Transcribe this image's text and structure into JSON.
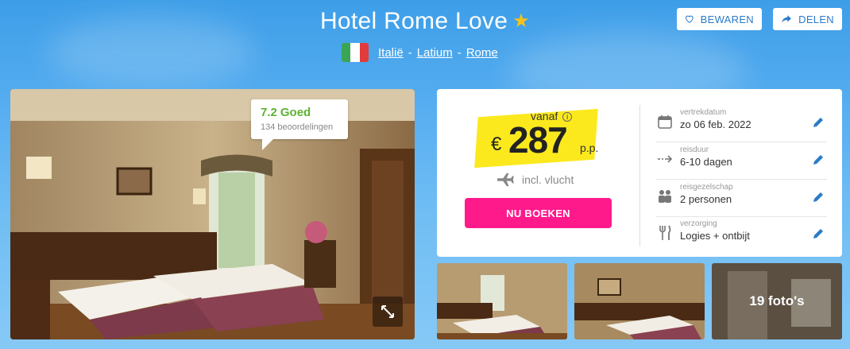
{
  "header": {
    "title": "Hotel Rome Love",
    "star": "★",
    "location": [
      "Italië",
      "Latium",
      "Rome"
    ],
    "separator": "-"
  },
  "actions": {
    "save_label": "BEWAREN",
    "share_label": "DELEN"
  },
  "rating": {
    "score": "7.2",
    "label": "Goed",
    "count": "134 beoordelingen"
  },
  "price": {
    "prefix": "vanaf",
    "info": "i",
    "currency": "€",
    "amount": "287",
    "suffix": "p.p.",
    "flight_label": "incl. vlucht",
    "book_label": "NU BOEKEN"
  },
  "details": [
    {
      "icon": "calendar-icon",
      "label": "vertrekdatum",
      "value": "zo 06 feb. 2022"
    },
    {
      "icon": "duration-icon",
      "label": "reisduur",
      "value": "6-10 dagen"
    },
    {
      "icon": "people-icon",
      "label": "reisgezelschap",
      "value": "2 personen"
    },
    {
      "icon": "cutlery-icon",
      "label": "verzorging",
      "value": "Logies + ontbijt"
    }
  ],
  "gallery": {
    "photo_count_label": "19 foto's"
  },
  "colors": {
    "accent": "#ff1a8c",
    "link": "#2a7bc8",
    "rating": "#5cb233",
    "price_highlight": "#fbe91e"
  }
}
